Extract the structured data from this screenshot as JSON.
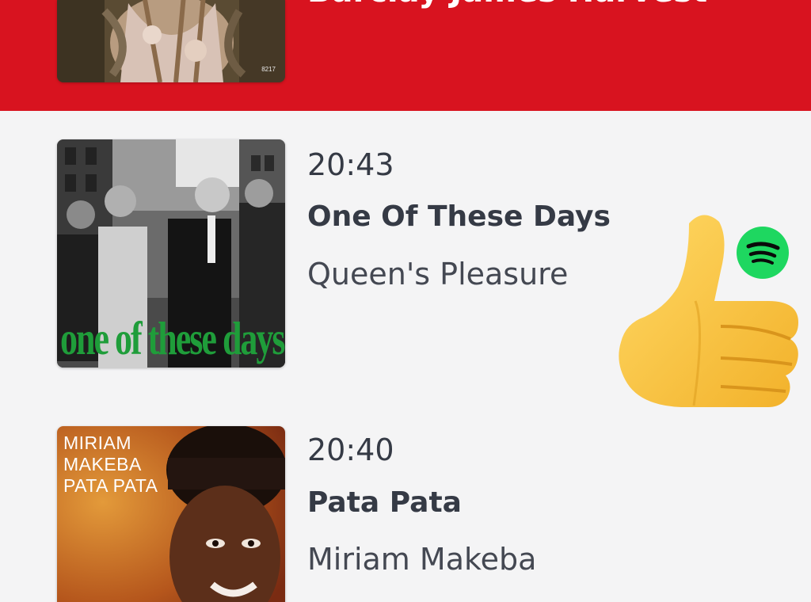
{
  "now_playing": {
    "title": "Barclay James Harvest",
    "cover_catalog": "8217"
  },
  "tracks": [
    {
      "time": "20:43",
      "title": "One Of These Days",
      "artist": "Queen's Pleasure",
      "cover_text": "one of these days"
    },
    {
      "time": "20:40",
      "title": "Pata Pata",
      "artist": "Miriam Makeba",
      "cover_lines": [
        "MIRIAM",
        "MAKEBA",
        "PATA PATA"
      ]
    }
  ],
  "overlay": {
    "emoji": "thumbs-up-icon",
    "badge": "spotify-icon"
  },
  "colors": {
    "header_red": "#d8131f",
    "text_dark": "#353a45",
    "spotify_green": "#1ed760",
    "background": "#f4f4f5"
  }
}
